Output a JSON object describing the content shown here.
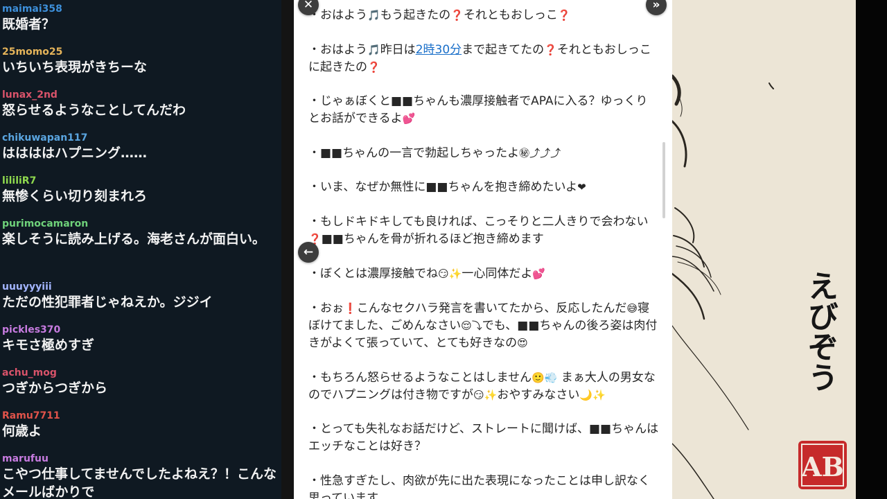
{
  "chat": {
    "messages": [
      {
        "user": "maimai358",
        "text": "既婚者？",
        "color": "#3d8fd9"
      },
      {
        "user": "25momo25",
        "text": "いちいち表現がきちーな",
        "color": "#e5b45a"
      },
      {
        "user": "lunax_2nd",
        "text": "怒らせるようなことしてんだわ",
        "color": "#d9536a"
      },
      {
        "user": "chikuwapan117",
        "text": "ははははハプニング……",
        "color": "#5aa5e0"
      },
      {
        "user": "lililiR7",
        "text": "無惨くらい切り刻まれろ",
        "color": "#8fd94e"
      },
      {
        "user": "purimocamaron",
        "text": "楽しそうに読み上げる。海老さんが面白い。",
        "color": "#6fd27a"
      },
      {
        "user": "uuuyyyiii",
        "text": "ただの性犯罪者じゃねえか。ジジイ",
        "color": "#a3b5ff"
      },
      {
        "user": "pickles370",
        "text": "キモさ極めすぎ",
        "color": "#c77be0"
      },
      {
        "user": "achu_mog",
        "text": "つぎからつぎから",
        "color": "#d9536a"
      },
      {
        "user": "Ramu7711",
        "text": "何歳よ",
        "color": "#e0534a"
      },
      {
        "user": "marufuu",
        "text": "こやつ仕事してませんでしたよねえ？！こんなメールばかりで",
        "color": "#c77be0"
      }
    ]
  },
  "viewer": {
    "close_icon": "close-icon",
    "forward_icon": "double-chevron-right-icon",
    "back_icon": "arrow-left-icon",
    "paragraphs": [
      {
        "pre": "・おはよう",
        "e1": "🎵",
        "mid": "もう起きたの",
        "e2": "❓",
        "post": "それともおしっこ",
        "e3": "❓"
      },
      {
        "pre": "・おはよう",
        "e1": "🎵",
        "mid": "昨日は",
        "link": "2時30分",
        "post": "まで起きてたの",
        "e2": "❓",
        "post2": "それともおしっこに起きたの",
        "e3": "❓"
      },
      {
        "text": "・じゃぁぼくと■■ちゃんも濃厚接触者でAPAに入る？ゆっくりとお話ができるよ",
        "e1": "💕"
      },
      {
        "text": "・■■ちゃんの一言で勃起しちゃったよ",
        "e1": "㊙⤴⤴⤴"
      },
      {
        "text": "・いま、なぜか無性に■■ちゃんを抱き締めたいよ",
        "e1": "❤"
      },
      {
        "text": "・もしドキドキしても良ければ、こっそりと二人きりで会わない",
        "e1": "❓",
        "post": "■■ちゃんを骨が折れるほど抱き締めます"
      },
      {
        "text": "・ぼくとは濃厚接触でね",
        "e1": "😏✨",
        "post": "一心同体だよ",
        "e2": "💕"
      },
      {
        "text": "・おぉ",
        "e1": "❗",
        "post": "こんなセクハラ発言を書いてたから、反応したんだ",
        "e2": "😅",
        "post2": "寝ぼけてました、ごめんなさい",
        "e3": "😌⤵",
        "post3": "でも、■■ちゃんの後ろ姿は肉付きがよくて張っていて、とても好きなの",
        "e4": "😍"
      },
      {
        "text": "・もちろん怒らせるようなことはしません",
        "e1": "🙂💨",
        "post": " まぁ大人の男女なのでハプニングは付き物ですが",
        "e2": "😏✨",
        "post2": "おやすみなさい",
        "e3": "🌙✨"
      },
      {
        "text": "・とっても失礼なお話だけど、ストレートに聞けば、■■ちゃんはエッチなことは好き？"
      },
      {
        "text": "・性急すぎたし、肉欲が先に出た表現になったことは申し訳なく思っています"
      }
    ]
  },
  "deco": {
    "title": "えびぞう",
    "seal_text": "AB",
    "seal_color": "#c62a2a"
  }
}
